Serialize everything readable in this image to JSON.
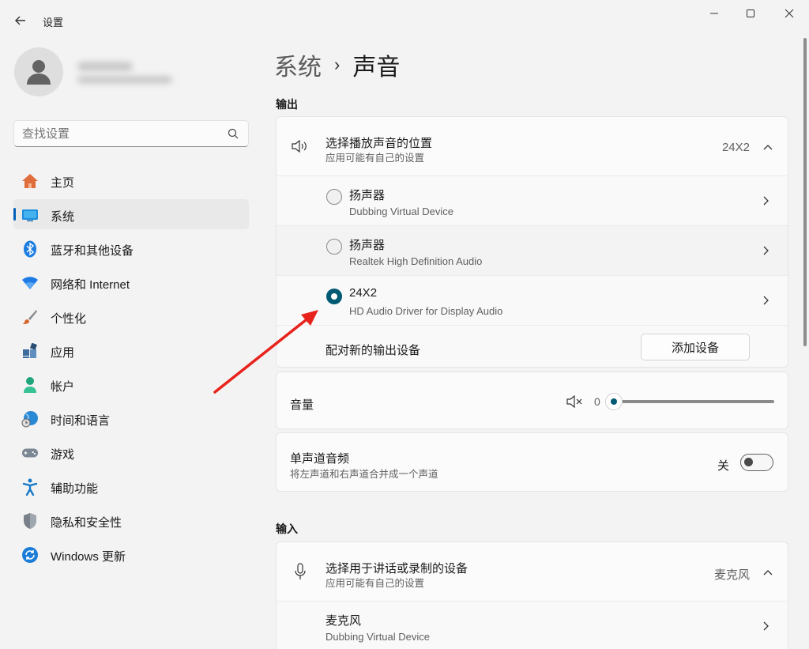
{
  "window": {
    "app_title": "设置",
    "back_icon": "back-arrow-icon",
    "controls": [
      "minimize-icon",
      "maximize-icon",
      "close-icon"
    ]
  },
  "search": {
    "placeholder": "查找设置"
  },
  "sidebar": {
    "items": [
      {
        "label": "主页",
        "icon": "home-icon",
        "color": "#e06d3c",
        "active": false
      },
      {
        "label": "系统",
        "icon": "system-icon",
        "color": "#1b8ddd",
        "active": true
      },
      {
        "label": "蓝牙和其他设备",
        "icon": "bluetooth-icon",
        "color": "#1b7de0",
        "active": false
      },
      {
        "label": "网络和 Internet",
        "icon": "wifi-icon",
        "color": "#1e7be6",
        "active": false
      },
      {
        "label": "个性化",
        "icon": "brush-icon",
        "color": "#d6682b",
        "active": false
      },
      {
        "label": "应用",
        "icon": "apps-icon",
        "color": "#3d6d9c",
        "active": false
      },
      {
        "label": "帐户",
        "icon": "account-icon",
        "color": "#1fa57b",
        "active": false
      },
      {
        "label": "时间和语言",
        "icon": "globe-clock-icon",
        "color": "#2a88d4",
        "active": false
      },
      {
        "label": "游戏",
        "icon": "gamepad-icon",
        "color": "#7b8794",
        "active": false
      },
      {
        "label": "辅助功能",
        "icon": "accessibility-icon",
        "color": "#1478c8",
        "active": false
      },
      {
        "label": "隐私和安全性",
        "icon": "shield-icon",
        "color": "#7a8089",
        "active": false
      },
      {
        "label": "Windows 更新",
        "icon": "update-icon",
        "color": "#1b7dd8",
        "active": false
      }
    ]
  },
  "breadcrumb": {
    "parent": "系统",
    "separator": "›",
    "current": "声音"
  },
  "output": {
    "section_label": "输出",
    "choose_device": {
      "title": "选择播放声音的位置",
      "subtitle": "应用可能有自己的设置",
      "value": "24X2"
    },
    "devices": [
      {
        "name": "扬声器",
        "driver": "Dubbing Virtual Device",
        "selected": false
      },
      {
        "name": "扬声器",
        "driver": "Realtek High Definition Audio",
        "selected": false
      },
      {
        "name": "24X2",
        "driver": "HD Audio Driver for Display Audio",
        "selected": true
      }
    ],
    "pair_new": {
      "label": "配对新的输出设备",
      "button": "添加设备"
    },
    "volume": {
      "label": "音量",
      "value": "0",
      "icon": "speaker-muted-icon"
    },
    "mono": {
      "title": "单声道音频",
      "subtitle": "将左声道和右声道合并成一个声道",
      "state": "关"
    }
  },
  "input": {
    "section_label": "输入",
    "choose_device": {
      "title": "选择用于讲话或录制的设备",
      "subtitle": "应用可能有自己的设置",
      "value": "麦克风"
    },
    "devices": [
      {
        "name": "麦克风",
        "driver": "Dubbing Virtual Device"
      }
    ]
  },
  "colors": {
    "accent": "#005fb8",
    "radio_checked": "#005a73",
    "annotation_arrow": "#e8231c"
  }
}
